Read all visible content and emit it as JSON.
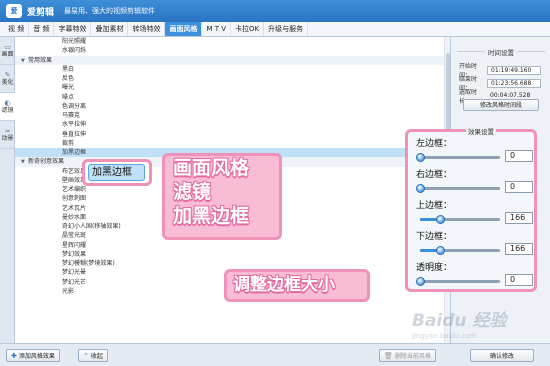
{
  "app": {
    "logo": "爱",
    "title": "爱剪辑",
    "slogan": "最易用、强大的视频剪辑软件"
  },
  "menu": [
    {
      "label": "视 频",
      "active": false
    },
    {
      "label": "音 频",
      "active": false
    },
    {
      "label": "字幕特效",
      "active": false
    },
    {
      "label": "叠加素材",
      "active": false
    },
    {
      "label": "转场特效",
      "active": false
    },
    {
      "label": "画面风格",
      "active": true
    },
    {
      "label": "M T V",
      "active": false
    },
    {
      "label": "卡拉OK",
      "active": false
    },
    {
      "label": "升级与服务",
      "active": false
    }
  ],
  "sidetabs": [
    {
      "icon": "▭",
      "label": "画面",
      "active": false
    },
    {
      "icon": "✎",
      "label": "美化",
      "active": false
    },
    {
      "icon": "◐",
      "label": "滤镜",
      "active": true
    },
    {
      "icon": "≈",
      "label": "动景",
      "active": false
    }
  ],
  "effects": [
    {
      "label": "阳光照耀",
      "type": "item"
    },
    {
      "label": "水银闪烁",
      "type": "item"
    },
    {
      "label": "常用效果",
      "type": "cat"
    },
    {
      "label": "黑白",
      "type": "item"
    },
    {
      "label": "反色",
      "type": "item"
    },
    {
      "label": "曝光",
      "type": "item"
    },
    {
      "label": "噪点",
      "type": "item"
    },
    {
      "label": "色调分离",
      "type": "item"
    },
    {
      "label": "马赛克",
      "type": "item"
    },
    {
      "label": "水平拉伸",
      "type": "item"
    },
    {
      "label": "垂直拉伸",
      "type": "item"
    },
    {
      "label": "裁剪",
      "type": "item"
    },
    {
      "label": "加黑边框",
      "type": "item",
      "selected": true
    },
    {
      "label": "新奇创意效果",
      "type": "cat"
    },
    {
      "label": "布艺效果",
      "type": "item"
    },
    {
      "label": "壁画效果",
      "type": "item"
    },
    {
      "label": "艺术编织",
      "type": "item"
    },
    {
      "label": "创意刺图",
      "type": "item"
    },
    {
      "label": "艺术瓦片",
      "type": "item"
    },
    {
      "label": "曼妙水面",
      "type": "item"
    },
    {
      "label": "奇幻小人国(移轴效果)",
      "type": "item"
    },
    {
      "label": "晶莹光斑",
      "type": "item"
    },
    {
      "label": "星辉闪耀",
      "type": "item"
    },
    {
      "label": "梦幻效果",
      "type": "item"
    },
    {
      "label": "梦幻模糊(梦境效果)",
      "type": "item"
    },
    {
      "label": "梦幻光晕",
      "type": "item"
    },
    {
      "label": "梦幻光芒",
      "type": "item"
    },
    {
      "label": "光影",
      "type": "item"
    }
  ],
  "time_settings": {
    "title": "时间设置",
    "start_label": "开始时间：",
    "start_value": "01:19:49.160",
    "end_label": "结束时间：",
    "end_value": "01:23:56.688",
    "duration_label": "选取时长：",
    "duration_value": "00:04:07.528",
    "reset_button": "修改风格时间段"
  },
  "effect_settings": {
    "title": "效果设置",
    "params": [
      {
        "label": "左边框：",
        "value": "0",
        "fraction": 0.0
      },
      {
        "label": "右边框：",
        "value": "0",
        "fraction": 0.0
      },
      {
        "label": "上边框：",
        "value": "166",
        "fraction": 0.25
      },
      {
        "label": "下边框：",
        "value": "166",
        "fraction": 0.25
      },
      {
        "label": "透明度：",
        "value": "0",
        "fraction": 0.0
      }
    ]
  },
  "bottom": {
    "add_button": "添加风格效果",
    "collect_button": "收起",
    "delete_button": "删除当前风格",
    "confirm_button": "确认修改"
  },
  "callouts": {
    "selected_effect": "加黑边框",
    "big_lines": [
      "画面风格",
      "滤镜",
      "加黑边框"
    ],
    "adjust": "调整边框大小"
  },
  "watermark": {
    "main": "Baidu 经验",
    "sub": "jingyan.baidu.com"
  },
  "colors": {
    "accent": "#3d8fe0",
    "highlight": "#ef92b9",
    "callout_bg": "#f8bcd5",
    "selected_row": "#bfe0f7"
  }
}
